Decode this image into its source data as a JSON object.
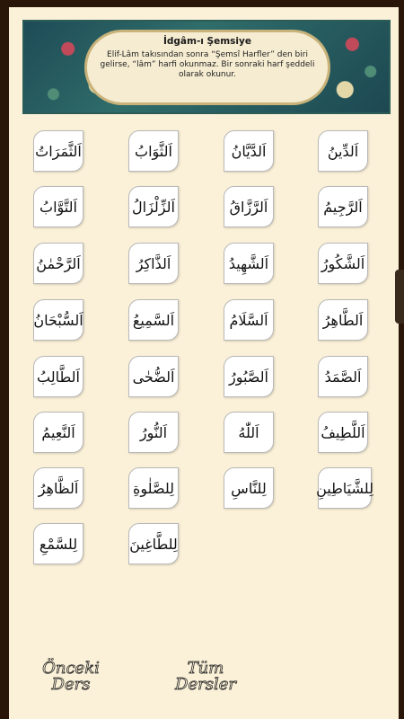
{
  "header": {
    "title": "İdgâm-ı Şemsiye",
    "description": "Elif-Lâm takısından sonra “Şemsî Harfler” den biri gelirse, “lâm” harfi okunmaz. Bir sonraki harf şeddeli olarak okunur."
  },
  "cards": [
    "اَلدِّينُ",
    "اَلدَّيَّانُ",
    "اَلثَّوَابُ",
    "اَلثَّمَرَاتُ",
    "اَلرَّجِيمُ",
    "اَلرَّزَّاقُ",
    "اَلزِّلْزَالُ",
    "اَلتَّوَّابُ",
    "اَلشَّكُورُ",
    "اَلشَّهِيدُ",
    "اَلذَّاكِرُ",
    "اَلرَّحْمٰنُ",
    "اَلطَّاهِرُ",
    "اَلسَّلَامُ",
    "اَلسَّمِيعُ",
    "اَلسُّبْحَانُ",
    "اَلصَّمَدُ",
    "اَلصَّبُورُ",
    "اَلضُّحٰى",
    "اَلطَّالِبُ",
    "اَللَّطِيفُ",
    "اَللّٰهُ",
    "اَلنُّورُ",
    "اَلنَّعِيمُ",
    "لِلشَّيَاطِينِ",
    "لِلنَّاسِ",
    "لِلصَّلٰوةِ",
    "اَلظَّاهِرُ",
    "لِلطَّاغِينَ",
    "لِلسَّمْعِ"
  ],
  "footer": {
    "prev_label": "Önceki Ders",
    "all_label": "Tüm Dersler"
  }
}
